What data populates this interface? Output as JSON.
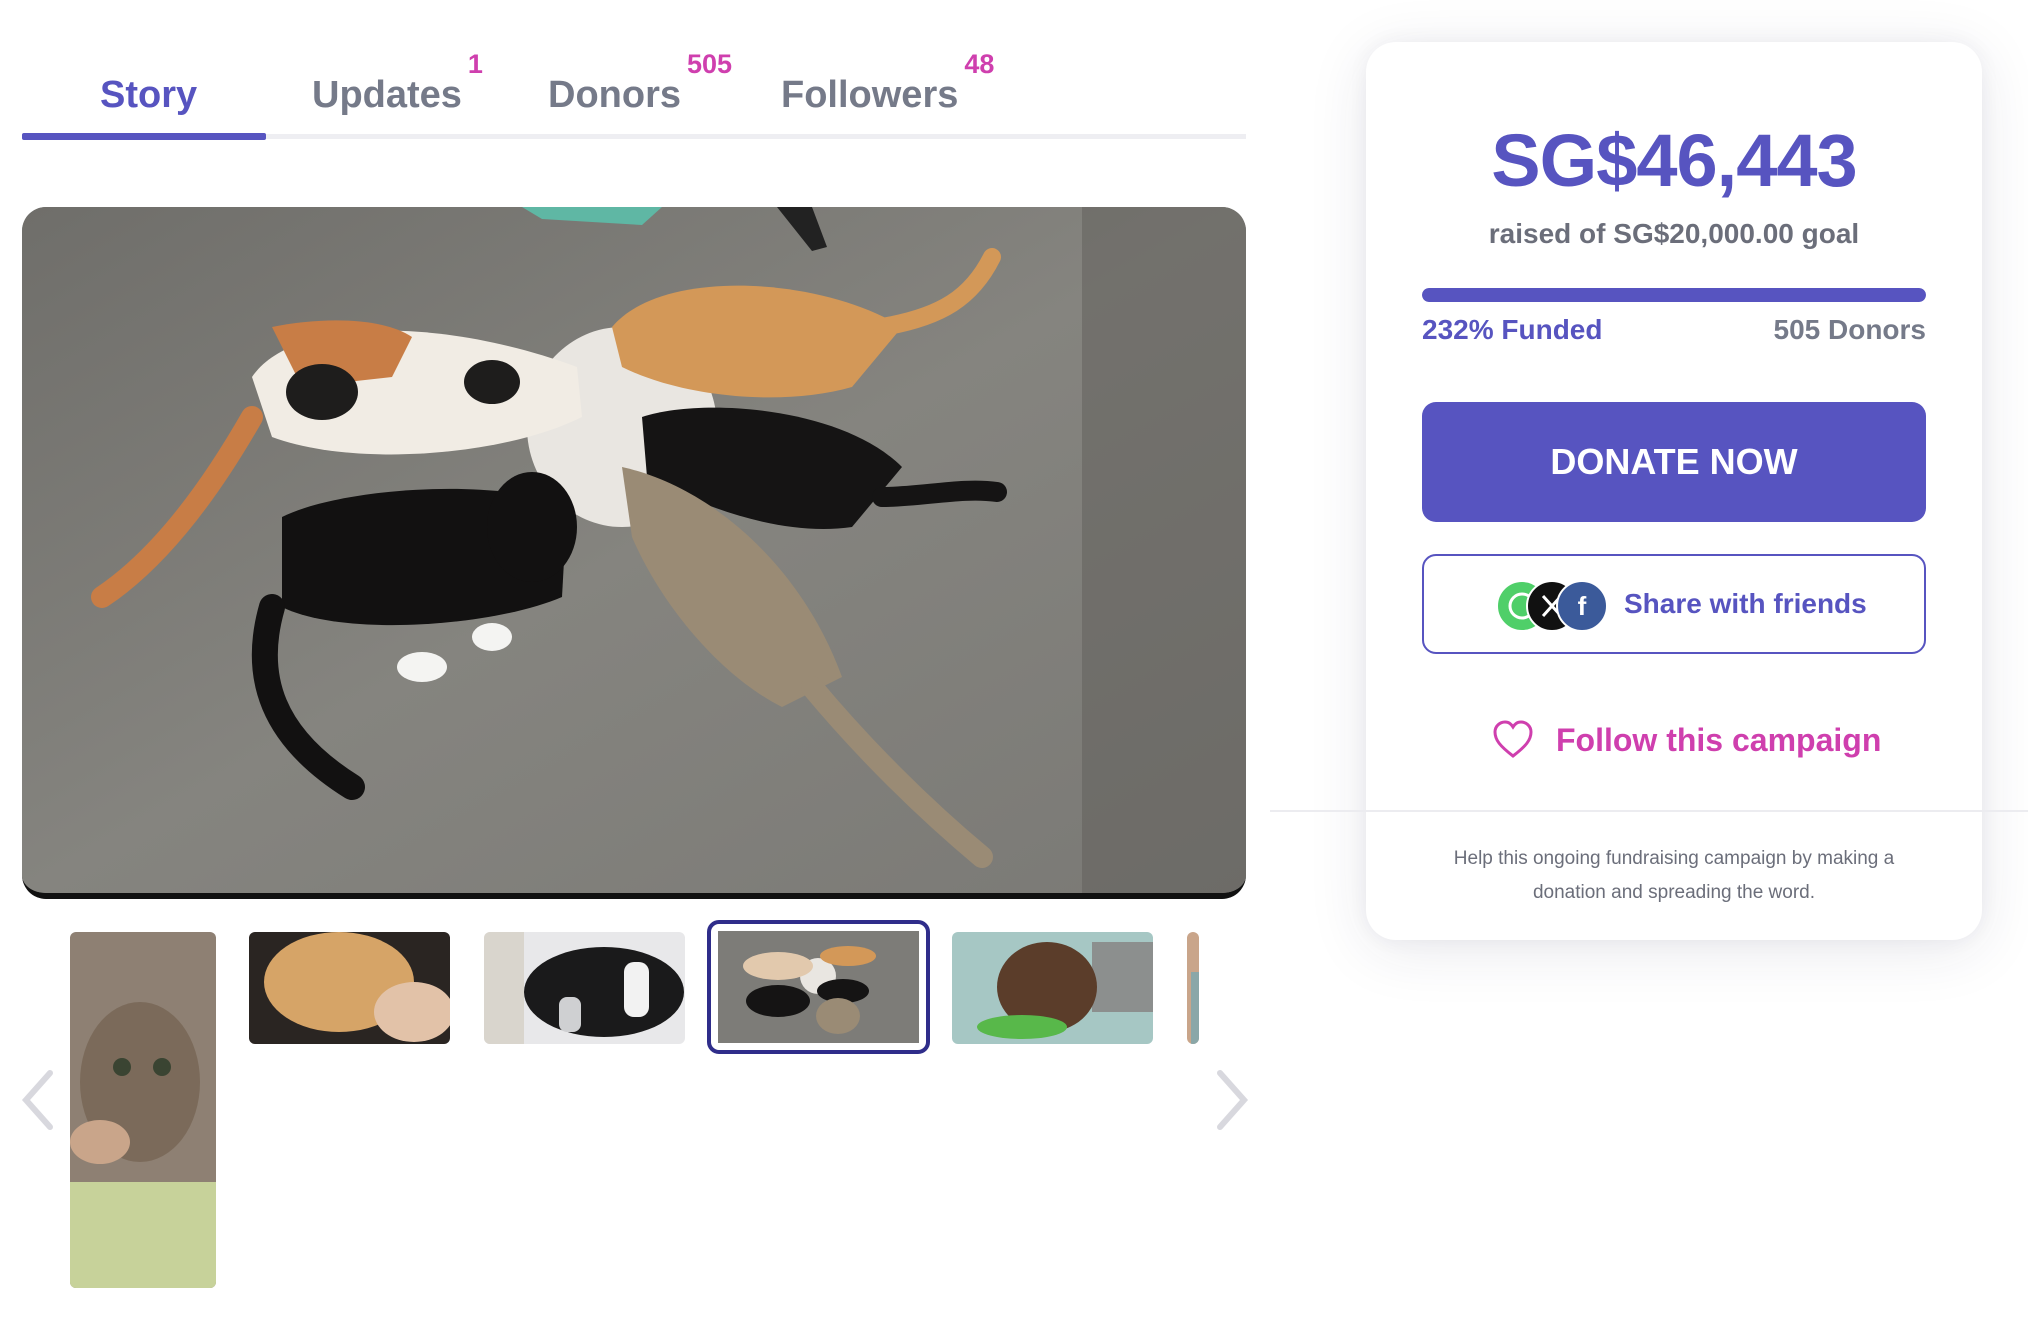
{
  "tabs": [
    {
      "label": "Story",
      "count": "",
      "active": true
    },
    {
      "label": "Updates",
      "count": "1"
    },
    {
      "label": "Donors",
      "count": "505"
    },
    {
      "label": "Followers",
      "count": "48"
    }
  ],
  "card": {
    "raised": "SG$46,443",
    "goal_text": "raised of SG$20,000.00 goal",
    "progress_fraction": 1.0,
    "funded_text": "232% Funded",
    "donors_text": "505 Donors",
    "donate_label": "DONATE NOW",
    "share_label": "Share with friends",
    "share_icons": [
      "whatsapp-icon",
      "x-icon",
      "facebook-icon"
    ],
    "follow_label": "Follow this campaign",
    "help_text": "Help this ongoing fundraising campaign by making a donation and spreading the word."
  },
  "gallery": {
    "selected_index": 3,
    "thumbnails": [
      "tabby-cat-closeup",
      "ginger-cat-petted",
      "black-cat-bandaged-legs",
      "cats-eating-from-plate",
      "tortoiseshell-cat-in-carrier",
      "partial-thumbnail"
    ]
  },
  "colors": {
    "accent": "#5754c0",
    "pink": "#cf3fae",
    "muted": "#757a89"
  }
}
